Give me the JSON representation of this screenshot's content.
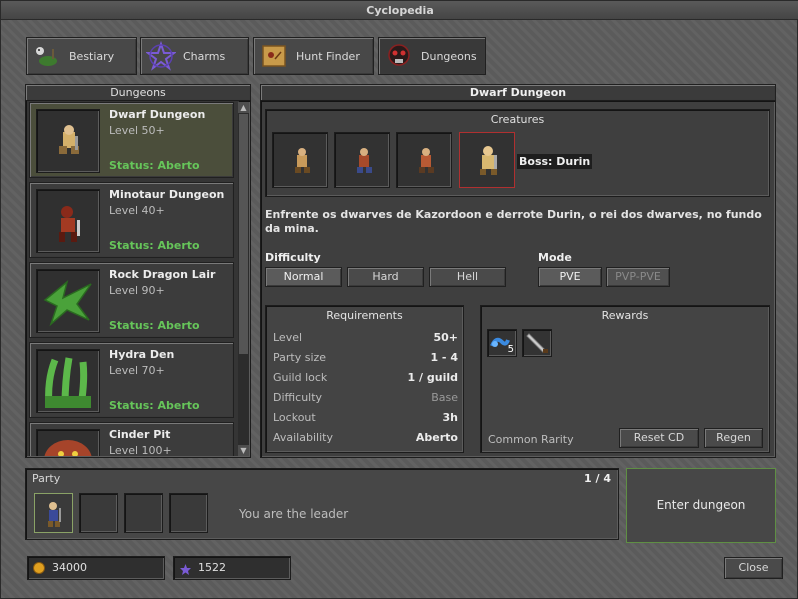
{
  "window": {
    "title": "Cyclopedia"
  },
  "tabs": [
    {
      "label": "Bestiary",
      "icon": "bestiary-icon"
    },
    {
      "label": "Charms",
      "icon": "charm-pentagram-icon"
    },
    {
      "label": "Hunt Finder",
      "icon": "map-scroll-icon"
    },
    {
      "label": "Dungeons",
      "icon": "dungeon-skull-icon",
      "active": true
    }
  ],
  "dungeon_list": {
    "header": "Dungeons",
    "items": [
      {
        "name": "Dwarf Dungeon",
        "level": "Level 50+",
        "status": "Status: Aberto",
        "selected": true
      },
      {
        "name": "Minotaur Dungeon",
        "level": "Level 40+",
        "status": "Status: Aberto"
      },
      {
        "name": "Rock Dragon Lair",
        "level": "Level 90+",
        "status": "Status: Aberto"
      },
      {
        "name": "Hydra Den",
        "level": "Level 70+",
        "status": "Status: Aberto"
      },
      {
        "name": "Cinder Pit",
        "level": "Level 100+",
        "status": ""
      }
    ]
  },
  "detail": {
    "title": "Dwarf Dungeon",
    "creatures_header": "Creatures",
    "boss_label": "Boss: Durin",
    "description": "Enfrente os dwarves de Kazordoon e derrote Durin, o rei dos dwarves, no fundo da mina.",
    "difficulty_label": "Difficulty",
    "difficulty_options": [
      "Normal",
      "Hard",
      "Hell"
    ],
    "difficulty_selected": "Normal",
    "mode_label": "Mode",
    "mode_options": [
      "PVE",
      "PVP-PVE"
    ],
    "mode_selected": "PVE",
    "requirements": {
      "header": "Requirements",
      "rows": [
        {
          "key": "Level",
          "value": "50+"
        },
        {
          "key": "Party size",
          "value": "1 - 4"
        },
        {
          "key": "Guild lock",
          "value": "1 / guild"
        },
        {
          "key": "Difficulty",
          "value": "Base"
        },
        {
          "key": "Lockout",
          "value": "3h"
        },
        {
          "key": "Availability",
          "value": "Aberto"
        }
      ]
    },
    "rewards": {
      "header": "Rewards",
      "items": [
        {
          "icon": "blue-potion-icon",
          "count": "5"
        },
        {
          "icon": "knife-icon",
          "count": ""
        }
      ],
      "rarity": "Common Rarity",
      "reset_cd_label": "Reset CD",
      "regen_label": "Regen"
    }
  },
  "party": {
    "header": "Party",
    "count": "1 / 4",
    "leader_text": "You are the leader",
    "enter_label": "Enter dungeon"
  },
  "footer": {
    "gold": "34000",
    "tokens": "1522",
    "close_label": "Close"
  },
  "colors": {
    "status_green": "#66c55a",
    "boss_border": "#b03030",
    "enter_border": "#5f8f44"
  }
}
